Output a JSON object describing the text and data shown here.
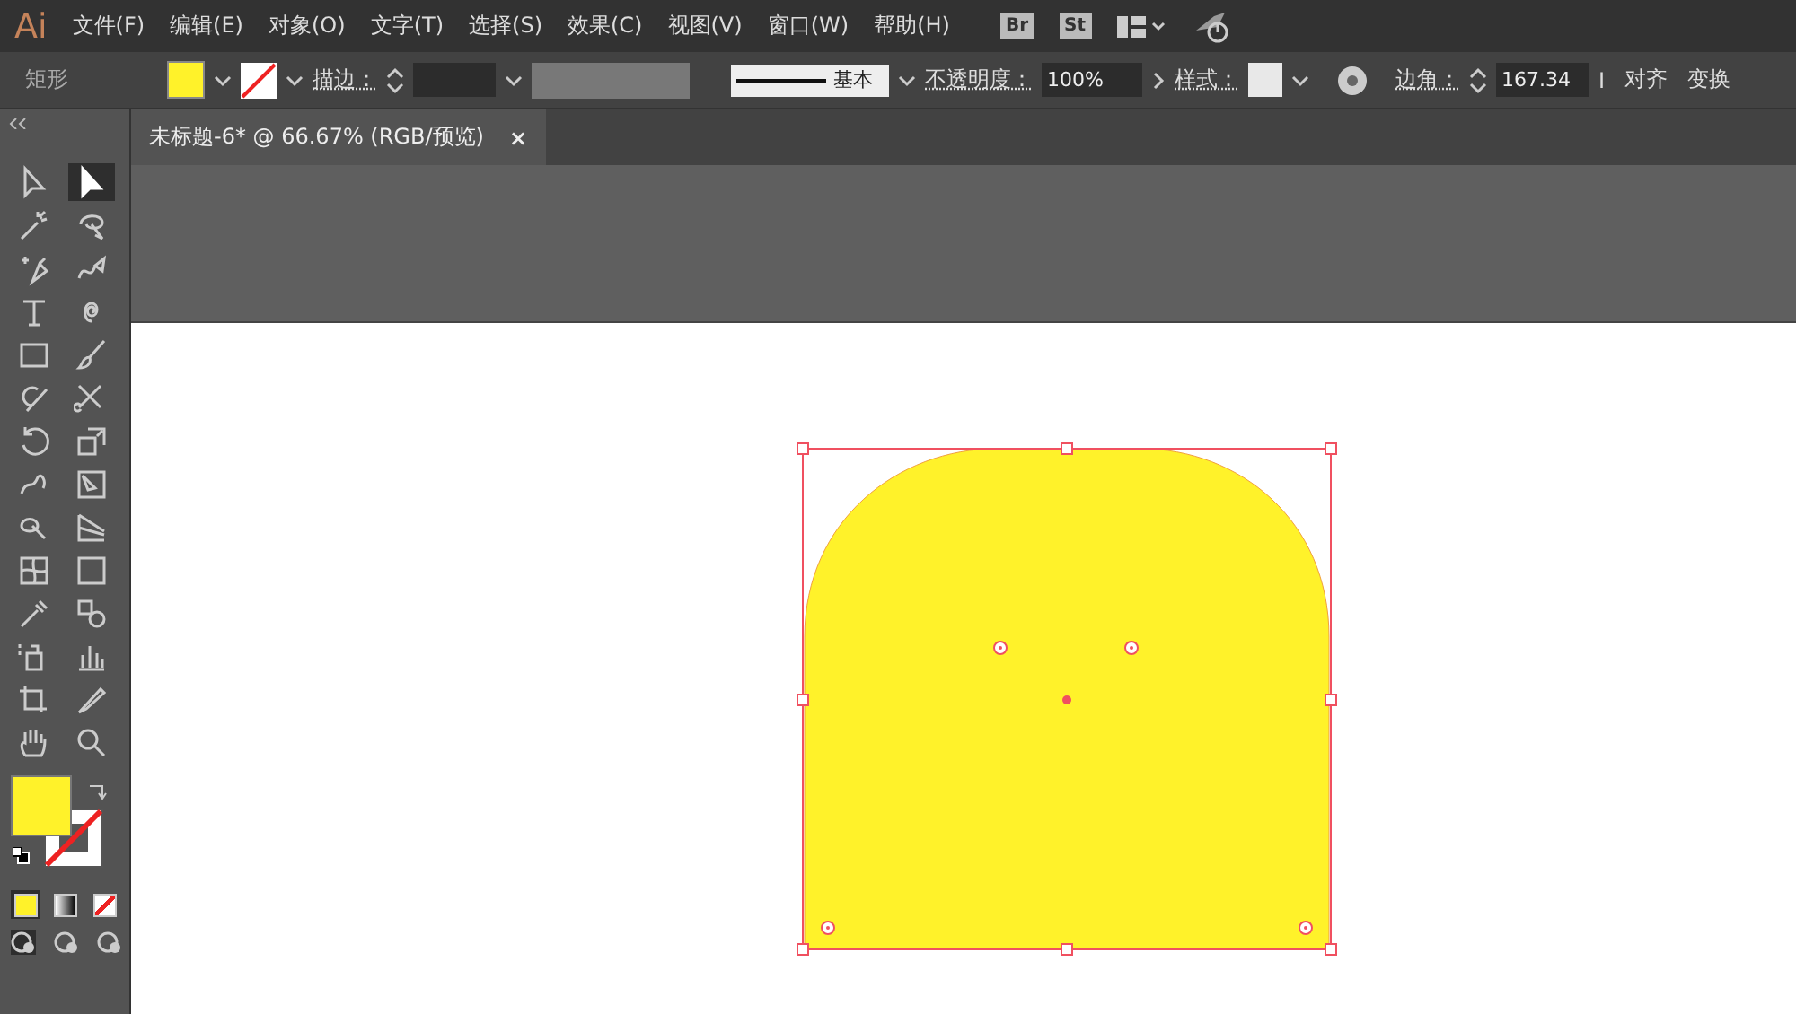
{
  "app": {
    "logo": "Ai"
  },
  "menu": [
    "文件(F)",
    "编辑(E)",
    "对象(O)",
    "文字(T)",
    "选择(S)",
    "效果(C)",
    "视图(V)",
    "窗口(W)",
    "帮助(H)"
  ],
  "menu_badges": [
    "Br",
    "St"
  ],
  "control_bar": {
    "object_type": "矩形",
    "stroke_label": "描边：",
    "stroke_profile": "基本",
    "opacity_label": "不透明度：",
    "opacity": "100%",
    "style_label": "样式：",
    "corner_label": "边角：",
    "corner": "167.34",
    "corner_unit": "I",
    "align": "对齐",
    "transform": "变换"
  },
  "tab": {
    "title": "未标题-6* @ 66.67% (RGB/预览)",
    "close": "×"
  },
  "tools": [
    {
      "kind": "selection",
      "selected": false
    },
    {
      "kind": "direct",
      "selected": true
    },
    {
      "kind": "wand",
      "selected": false
    },
    {
      "kind": "lasso",
      "selected": false
    },
    {
      "kind": "pen",
      "selected": false
    },
    {
      "kind": "curvature",
      "selected": false
    },
    {
      "kind": "type",
      "selected": false
    },
    {
      "kind": "spiral",
      "selected": false
    },
    {
      "kind": "rectangle",
      "selected": false
    },
    {
      "kind": "brush",
      "selected": false
    },
    {
      "kind": "shaper",
      "selected": false
    },
    {
      "kind": "scissors",
      "selected": false
    },
    {
      "kind": "rotate",
      "selected": false
    },
    {
      "kind": "scale",
      "selected": false
    },
    {
      "kind": "warp",
      "selected": false
    },
    {
      "kind": "free-transform",
      "selected": false
    },
    {
      "kind": "shape-builder",
      "selected": false
    },
    {
      "kind": "perspective",
      "selected": false
    },
    {
      "kind": "mesh",
      "selected": false
    },
    {
      "kind": "gradient",
      "selected": false
    },
    {
      "kind": "eyedropper",
      "selected": false
    },
    {
      "kind": "blend",
      "selected": false
    },
    {
      "kind": "sprayer",
      "selected": false
    },
    {
      "kind": "graph",
      "selected": false
    },
    {
      "kind": "artboard",
      "selected": false
    },
    {
      "kind": "slice",
      "selected": false
    },
    {
      "kind": "hand",
      "selected": false
    },
    {
      "kind": "zoom",
      "selected": false
    }
  ]
}
